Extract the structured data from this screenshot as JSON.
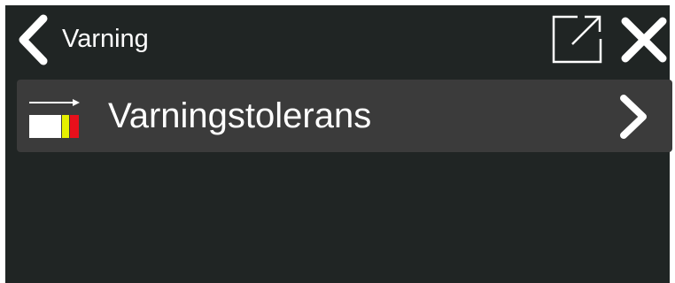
{
  "header": {
    "title": "Varning",
    "back_icon": "chevron-left-icon",
    "popout_icon": "external-link-icon",
    "close_icon": "close-icon"
  },
  "menu": {
    "items": [
      {
        "label": "Varningstolerans",
        "icon": "tolerance-bar-icon",
        "arrow_icon": "chevron-right-icon"
      }
    ]
  },
  "colors": {
    "background": "#202524",
    "row_background": "#3b3b3b",
    "text": "#ffffff",
    "tolerance_yellow": "#e6f000",
    "tolerance_red": "#e8101b"
  }
}
